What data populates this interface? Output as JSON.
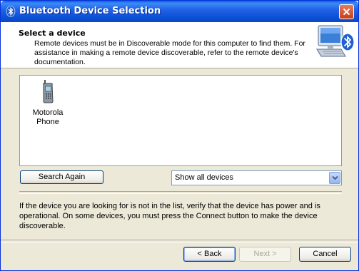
{
  "window": {
    "title": "Bluetooth Device Selection"
  },
  "header": {
    "title": "Select a device",
    "description": "Remote devices must be in Discoverable mode for this computer to find them. For assistance in making a remote device discoverable, refer to the remote device's documentation."
  },
  "devices": [
    {
      "label": "Motorola Phone",
      "icon": "cell-phone-icon"
    }
  ],
  "controls": {
    "search_again": "Search Again",
    "filter_selected": "Show all devices"
  },
  "info_text": "If the device you are looking for is not in the list, verify that the device has power and is operational. On some devices, you must press the Connect button to make the device discoverable.",
  "buttons": {
    "back": "< Back",
    "next": "Next >",
    "cancel": "Cancel"
  }
}
